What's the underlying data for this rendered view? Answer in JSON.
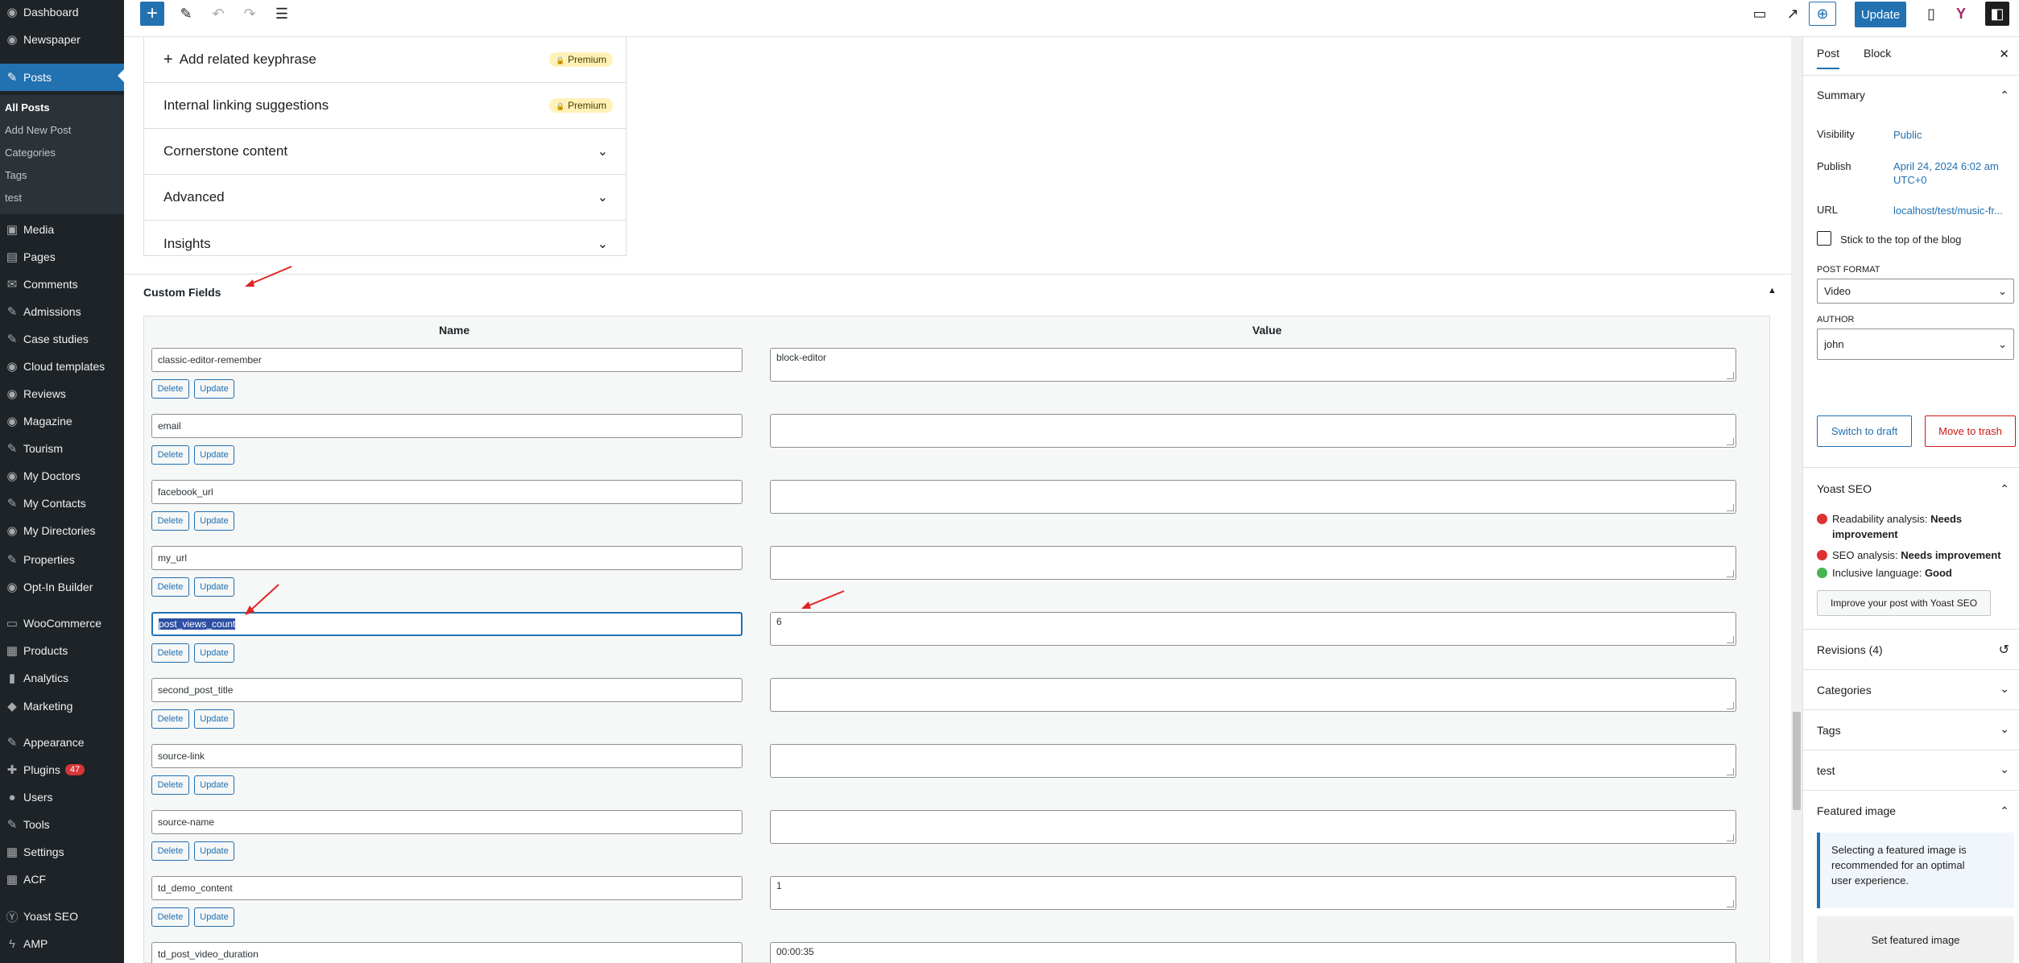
{
  "sidebar": {
    "items": [
      {
        "icon": "dashboard-icon",
        "glyph": "◉",
        "label": "Dashboard"
      },
      {
        "icon": "newspaper-icon",
        "glyph": "◉",
        "label": "Newspaper"
      },
      {
        "icon": "posts-icon",
        "glyph": "✎",
        "label": "Posts"
      },
      {
        "icon": "media-icon",
        "glyph": "▣",
        "label": "Media"
      },
      {
        "icon": "pages-icon",
        "glyph": "▤",
        "label": "Pages"
      },
      {
        "icon": "comments-icon",
        "glyph": "✉",
        "label": "Comments"
      },
      {
        "icon": "admissions-icon",
        "glyph": "✎",
        "label": "Admissions"
      },
      {
        "icon": "case-studies-icon",
        "glyph": "✎",
        "label": "Case studies"
      },
      {
        "icon": "cloud-templates-icon",
        "glyph": "◉",
        "label": "Cloud templates"
      },
      {
        "icon": "reviews-icon",
        "glyph": "◉",
        "label": "Reviews"
      },
      {
        "icon": "magazine-icon",
        "glyph": "◉",
        "label": "Magazine"
      },
      {
        "icon": "tourism-icon",
        "glyph": "✎",
        "label": "Tourism"
      },
      {
        "icon": "my-doctors-icon",
        "glyph": "◉",
        "label": "My Doctors"
      },
      {
        "icon": "my-contacts-icon",
        "glyph": "✎",
        "label": "My Contacts"
      },
      {
        "icon": "my-directories-icon",
        "glyph": "◉",
        "label": "My Directories"
      },
      {
        "icon": "properties-icon",
        "glyph": "✎",
        "label": "Properties"
      },
      {
        "icon": "opt-in-builder-icon",
        "glyph": "◉",
        "label": "Opt-In Builder"
      },
      {
        "icon": "woocommerce-icon",
        "glyph": "▭",
        "label": "WooCommerce"
      },
      {
        "icon": "products-icon",
        "glyph": "▦",
        "label": "Products"
      },
      {
        "icon": "analytics-icon",
        "glyph": "▮",
        "label": "Analytics"
      },
      {
        "icon": "marketing-icon",
        "glyph": "◆",
        "label": "Marketing"
      },
      {
        "icon": "appearance-icon",
        "glyph": "✎",
        "label": "Appearance"
      },
      {
        "icon": "plugins-icon",
        "glyph": "✚",
        "label": "Plugins"
      },
      {
        "icon": "users-icon",
        "glyph": "●",
        "label": "Users"
      },
      {
        "icon": "tools-icon",
        "glyph": "✎",
        "label": "Tools"
      },
      {
        "icon": "settings-icon",
        "glyph": "▦",
        "label": "Settings"
      },
      {
        "icon": "acf-icon",
        "glyph": "▦",
        "label": "ACF"
      },
      {
        "icon": "yoast-seo-icon",
        "glyph": "Ⓨ",
        "label": "Yoast SEO"
      },
      {
        "icon": "amp-icon",
        "glyph": "ϟ",
        "label": "AMP"
      }
    ],
    "submenu": [
      "All Posts",
      "Add New Post",
      "Categories",
      "Tags",
      "test"
    ],
    "plugins_badge": "47"
  },
  "toolbar": {
    "add_glyph": "+",
    "tools_glyph": "✎",
    "undo_glyph": "↶",
    "redo_glyph": "↷",
    "outline_glyph": "☰",
    "preview_glyph": "▭",
    "view_glyph": "↗",
    "info_glyph": "⊕",
    "update_label": "Update",
    "mobile_glyph": "▯",
    "yoast_glyph": "Y",
    "settings_glyph": "◧"
  },
  "yoast_panel": {
    "rows": [
      {
        "label": "Add related keyphrase",
        "prefix": "+",
        "premium": "Premium"
      },
      {
        "label": "Internal linking suggestions",
        "premium": "Premium"
      },
      {
        "label": "Cornerstone content",
        "chevron": "⌄"
      },
      {
        "label": "Advanced",
        "chevron": "⌄"
      },
      {
        "label": "Insights",
        "chevron": "⌄"
      }
    ],
    "premium_lock_glyph": "🔒"
  },
  "custom_fields": {
    "title": "Custom Fields",
    "toggle_glyph": "▲",
    "col_name": "Name",
    "col_value": "Value",
    "delete_label": "Delete",
    "update_label": "Update",
    "rows": [
      {
        "name": "classic-editor-remember",
        "value": "block-editor"
      },
      {
        "name": "email",
        "value": ""
      },
      {
        "name": "facebook_url",
        "value": ""
      },
      {
        "name": "my_url",
        "value": ""
      },
      {
        "name": "post_views_count",
        "value": "6"
      },
      {
        "name": "second_post_title",
        "value": ""
      },
      {
        "name": "source-link",
        "value": ""
      },
      {
        "name": "source-name",
        "value": ""
      },
      {
        "name": "td_demo_content",
        "value": "1"
      },
      {
        "name": "td_post_video_duration",
        "value": "00:00:35"
      }
    ]
  },
  "settings_sidebar": {
    "tab_post": "Post",
    "tab_block": "Block",
    "close_glyph": "✕",
    "summary": {
      "title": "Summary",
      "visibility_label": "Visibility",
      "visibility_value": "Public",
      "publish_label": "Publish",
      "publish_value_1": "April 24, 2024 6:02 am",
      "publish_value_2": "UTC+0",
      "url_label": "URL",
      "url_value": "localhost/test/music-fr...",
      "sticky_label": "Stick to the top of the blog",
      "post_format_label": "POST FORMAT",
      "post_format_value": "Video",
      "author_label": "AUTHOR",
      "author_value": "john",
      "switch_draft": "Switch to draft",
      "move_trash": "Move to trash"
    },
    "yoast": {
      "title": "Yoast SEO",
      "readability_label": "Readability analysis:",
      "readability_value_1": "Needs",
      "readability_value_2": "improvement",
      "seo_label": "SEO analysis:",
      "seo_value": "Needs improvement",
      "inclusive_label": "Inclusive language:",
      "inclusive_value": "Good",
      "improve_button": "Improve your post with Yoast SEO",
      "bad_color": "#dc3232",
      "good_color": "#46b450"
    },
    "revisions": "Revisions (4)",
    "revisions_glyph": "↺",
    "categories": "Categories",
    "tags": "Tags",
    "test": "test",
    "featured_image": {
      "title": "Featured image",
      "notice_1": "Selecting a featured image is",
      "notice_2": "recommended for an optimal",
      "notice_3": "user experience.",
      "set_button": "Set featured image"
    }
  },
  "colors": {
    "accent": "#2271b1",
    "sidebar_bg": "#1d2327",
    "annotation": "#e02424"
  }
}
